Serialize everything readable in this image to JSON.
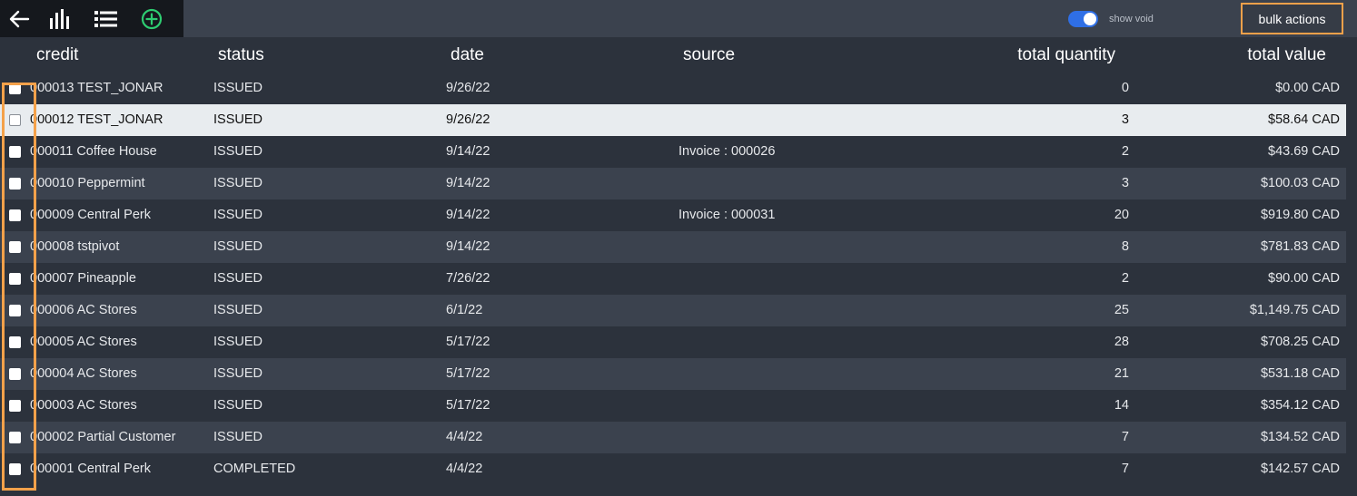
{
  "toolbar": {
    "icons": [
      "back-arrow-icon",
      "bar-chart-icon",
      "list-icon",
      "add-circle-icon"
    ],
    "show_void_label": "show void",
    "show_void_on": true,
    "bulk_actions_label": "bulk actions",
    "accent_color": "#f4a14a",
    "add_color": "#2ecc71",
    "toggle_color": "#2f6fe6"
  },
  "table": {
    "headers": {
      "credit": "credit",
      "status": "status",
      "date": "date",
      "source": "source",
      "total_quantity": "total quantity",
      "total_value": "total value"
    },
    "rows": [
      {
        "credit": "000013 TEST_JONAR",
        "status": "ISSUED",
        "date": "9/26/22",
        "source": "",
        "quantity": "0",
        "value": "$0.00 CAD",
        "selected": false
      },
      {
        "credit": "000012 TEST_JONAR",
        "status": "ISSUED",
        "date": "9/26/22",
        "source": "",
        "quantity": "3",
        "value": "$58.64 CAD",
        "selected": true
      },
      {
        "credit": "000011 Coffee House",
        "status": "ISSUED",
        "date": "9/14/22",
        "source": "Invoice : 000026",
        "quantity": "2",
        "value": "$43.69 CAD",
        "selected": false
      },
      {
        "credit": "000010 Peppermint",
        "status": "ISSUED",
        "date": "9/14/22",
        "source": "",
        "quantity": "3",
        "value": "$100.03 CAD",
        "selected": false
      },
      {
        "credit": "000009 Central Perk",
        "status": "ISSUED",
        "date": "9/14/22",
        "source": "Invoice : 000031",
        "quantity": "20",
        "value": "$919.80 CAD",
        "selected": false
      },
      {
        "credit": "000008 tstpivot",
        "status": "ISSUED",
        "date": "9/14/22",
        "source": "",
        "quantity": "8",
        "value": "$781.83 CAD",
        "selected": false
      },
      {
        "credit": "000007 Pineapple",
        "status": "ISSUED",
        "date": "7/26/22",
        "source": "",
        "quantity": "2",
        "value": "$90.00 CAD",
        "selected": false
      },
      {
        "credit": "000006 AC Stores",
        "status": "ISSUED",
        "date": "6/1/22",
        "source": "",
        "quantity": "25",
        "value": "$1,149.75 CAD",
        "selected": false
      },
      {
        "credit": "000005 AC Stores",
        "status": "ISSUED",
        "date": "5/17/22",
        "source": "",
        "quantity": "28",
        "value": "$708.25 CAD",
        "selected": false
      },
      {
        "credit": "000004 AC Stores",
        "status": "ISSUED",
        "date": "5/17/22",
        "source": "",
        "quantity": "21",
        "value": "$531.18 CAD",
        "selected": false
      },
      {
        "credit": "000003 AC Stores",
        "status": "ISSUED",
        "date": "5/17/22",
        "source": "",
        "quantity": "14",
        "value": "$354.12 CAD",
        "selected": false
      },
      {
        "credit": "000002 Partial Customer",
        "status": "ISSUED",
        "date": "4/4/22",
        "source": "",
        "quantity": "7",
        "value": "$134.52 CAD",
        "selected": false
      },
      {
        "credit": "000001 Central Perk",
        "status": "COMPLETED",
        "date": "4/4/22",
        "source": "",
        "quantity": "7",
        "value": "$142.57 CAD",
        "selected": false
      }
    ]
  }
}
